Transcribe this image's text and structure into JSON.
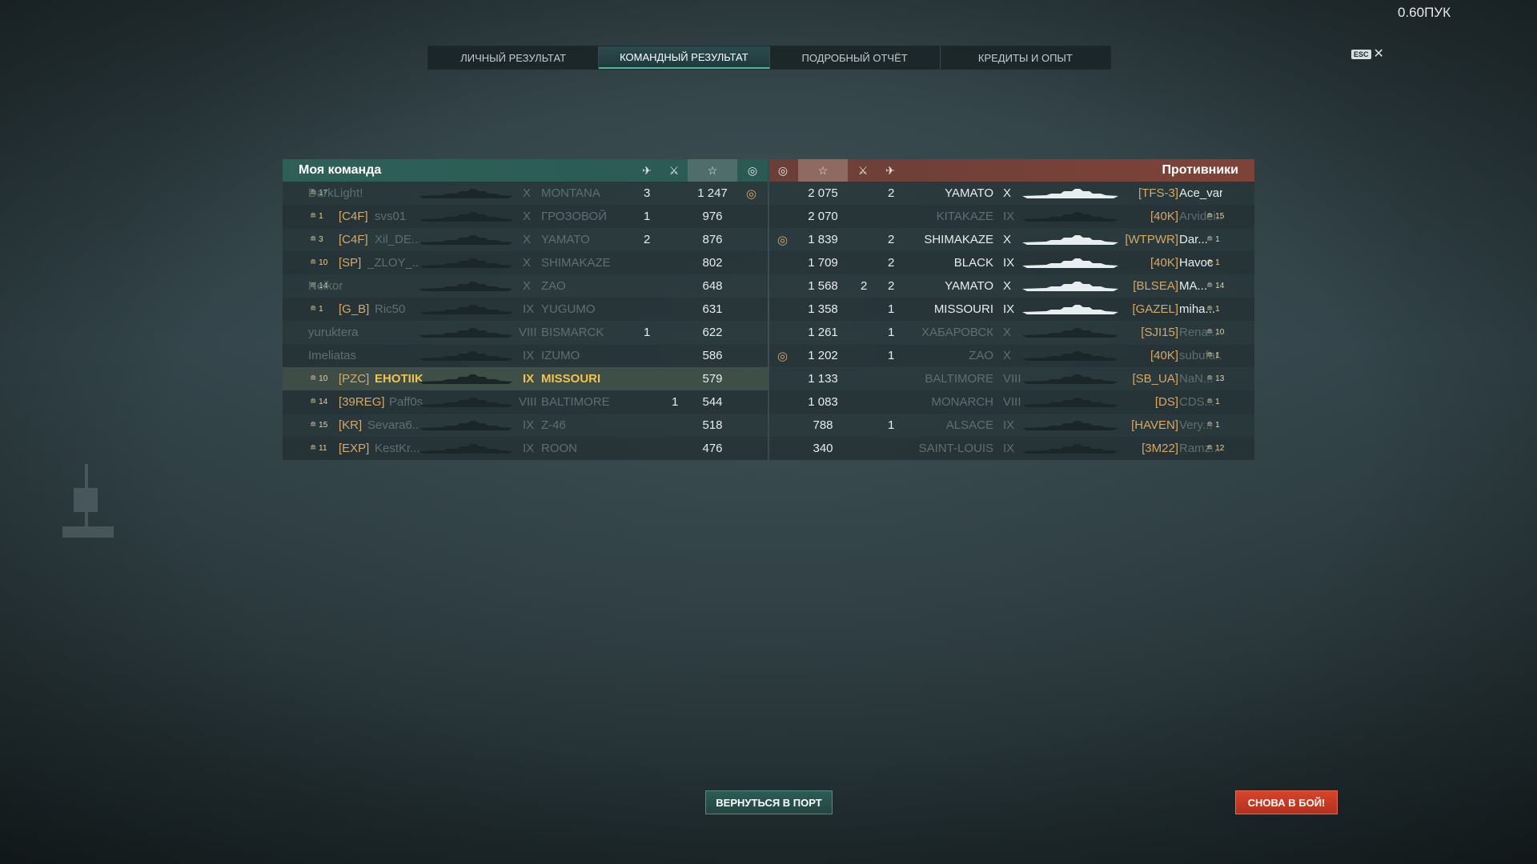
{
  "version": "0.60ПУК",
  "tabs": [
    {
      "label": "ЛИЧНЫЙ РЕЗУЛЬТАТ",
      "active": false
    },
    {
      "label": "КОМАНДНЫЙ РЕЗУЛЬТАТ",
      "active": true
    },
    {
      "label": "ПОДРОБНЫЙ ОТЧЁТ",
      "active": false
    },
    {
      "label": "КРЕДИТЫ И ОПЫТ",
      "active": false
    }
  ],
  "esc": {
    "key": "ESC",
    "close": "✕"
  },
  "my_team": {
    "title": "Моя команда",
    "header_icons": [
      "plane-icon",
      "crossed-swords-icon",
      "star-icon",
      "base-capture-icon"
    ],
    "rows": [
      {
        "rank": "17",
        "clan": "",
        "name": "DarkLight!",
        "tier": "X",
        "ship": "MONTANA",
        "planes": "3",
        "kills": "",
        "score": "1 247",
        "cap": "◎",
        "alive": false,
        "hl": false
      },
      {
        "rank": "1",
        "clan": "[C4F]",
        "name": "svs01",
        "tier": "X",
        "ship": "ГРОЗОВОЙ",
        "planes": "1",
        "kills": "",
        "score": "976",
        "cap": "",
        "alive": false,
        "hl": false
      },
      {
        "rank": "3",
        "clan": "[C4F]",
        "name": "Xil_DE...",
        "tier": "X",
        "ship": "YAMATO",
        "planes": "2",
        "kills": "",
        "score": "876",
        "cap": "",
        "alive": false,
        "hl": false
      },
      {
        "rank": "10",
        "clan": "[SP]",
        "name": "_ZLOY_...",
        "tier": "X",
        "ship": "SHIMAKAZE",
        "planes": "",
        "kills": "",
        "score": "802",
        "cap": "",
        "alive": false,
        "hl": false
      },
      {
        "rank": "14",
        "clan": "",
        "name": "Neikor",
        "tier": "X",
        "ship": "ZAO",
        "planes": "",
        "kills": "",
        "score": "648",
        "cap": "",
        "alive": false,
        "hl": false
      },
      {
        "rank": "1",
        "clan": "[G_B]",
        "name": "Ric50",
        "tier": "IX",
        "ship": "YUGUMO",
        "planes": "",
        "kills": "",
        "score": "631",
        "cap": "",
        "alive": false,
        "hl": false
      },
      {
        "rank": "",
        "clan": "",
        "name": "yuruktera",
        "tier": "VIII",
        "ship": "BISMARCK",
        "planes": "1",
        "kills": "",
        "score": "622",
        "cap": "",
        "alive": false,
        "hl": false
      },
      {
        "rank": "",
        "clan": "",
        "name": "Imeliatas",
        "tier": "IX",
        "ship": "IZUMO",
        "planes": "",
        "kills": "",
        "score": "586",
        "cap": "",
        "alive": false,
        "hl": false
      },
      {
        "rank": "10",
        "clan": "[PZC]",
        "name": "EHOTIIK",
        "tier": "IX",
        "ship": "MISSOURI",
        "planes": "",
        "kills": "",
        "score": "579",
        "cap": "",
        "alive": true,
        "hl": true
      },
      {
        "rank": "14",
        "clan": "[39REG]",
        "name": "Paff0s",
        "tier": "VIII",
        "ship": "BALTIMORE",
        "planes": "",
        "kills": "1",
        "score": "544",
        "cap": "",
        "alive": false,
        "hl": false
      },
      {
        "rank": "15",
        "clan": "[KR]",
        "name": "Sevara6...",
        "tier": "IX",
        "ship": "Z-46",
        "planes": "",
        "kills": "",
        "score": "518",
        "cap": "",
        "alive": false,
        "hl": false
      },
      {
        "rank": "11",
        "clan": "[EXP]",
        "name": "KestKr...",
        "tier": "IX",
        "ship": "ROON",
        "planes": "",
        "kills": "",
        "score": "476",
        "cap": "",
        "alive": false,
        "hl": false
      }
    ]
  },
  "enemy_team": {
    "title": "Противники",
    "header_icons": [
      "base-capture-icon",
      "star-icon",
      "crossed-swords-icon",
      "plane-icon"
    ],
    "rows": [
      {
        "cap": "",
        "score": "2 075",
        "kills": "",
        "planes": "2",
        "ship": "YAMATO",
        "tier": "X",
        "clan": "[TFS-3]",
        "name": "Ace_varvar",
        "rank": "",
        "alive": true
      },
      {
        "cap": "",
        "score": "2 070",
        "kills": "",
        "planes": "",
        "ship": "KITAKAZE",
        "tier": "IX",
        "clan": "[40K]",
        "name": "Arvidei...",
        "rank": "15",
        "alive": false
      },
      {
        "cap": "◎",
        "score": "1 839",
        "kills": "",
        "planes": "2",
        "ship": "SHIMAKAZE",
        "tier": "X",
        "clan": "[WTPWR]",
        "name": "Dar...",
        "rank": "1",
        "alive": true
      },
      {
        "cap": "",
        "score": "1 709",
        "kills": "",
        "planes": "2",
        "ship": "BLACK",
        "tier": "IX",
        "clan": "[40K]",
        "name": "Havoc",
        "rank": "1",
        "alive": true
      },
      {
        "cap": "",
        "score": "1 568",
        "kills": "2",
        "planes": "2",
        "ship": "YAMATO",
        "tier": "X",
        "clan": "[BLSEA]",
        "name": "MA...",
        "rank": "14",
        "alive": true
      },
      {
        "cap": "",
        "score": "1 358",
        "kills": "",
        "planes": "1",
        "ship": "MISSOURI",
        "tier": "IX",
        "clan": "[GAZEL]",
        "name": "miha...",
        "rank": "1",
        "alive": true
      },
      {
        "cap": "",
        "score": "1 261",
        "kills": "",
        "planes": "1",
        "ship": "ХАБАРОВСК",
        "tier": "X",
        "clan": "[SJI15]",
        "name": "Rena...",
        "rank": "10",
        "alive": false
      },
      {
        "cap": "◎",
        "score": "1 202",
        "kills": "",
        "planes": "1",
        "ship": "ZAO",
        "tier": "X",
        "clan": "[40K]",
        "name": "subufar...",
        "rank": "1",
        "alive": false
      },
      {
        "cap": "",
        "score": "1 133",
        "kills": "",
        "planes": "",
        "ship": "BALTIMORE",
        "tier": "VIII",
        "clan": "[SB_UA]",
        "name": "NaN...",
        "rank": "13",
        "alive": false
      },
      {
        "cap": "",
        "score": "1 083",
        "kills": "",
        "planes": "",
        "ship": "MONARCH",
        "tier": "VIII",
        "clan": "[DS]",
        "name": "CDS...",
        "rank": "1",
        "alive": false
      },
      {
        "cap": "",
        "score": "788",
        "kills": "",
        "planes": "1",
        "ship": "ALSACE",
        "tier": "IX",
        "clan": "[HAVEN]",
        "name": "Very...",
        "rank": "1",
        "alive": false
      },
      {
        "cap": "",
        "score": "340",
        "kills": "",
        "planes": "",
        "ship": "SAINT-LOUIS",
        "tier": "IX",
        "clan": "[3M22]",
        "name": "Ramz...",
        "rank": "12",
        "alive": false
      }
    ]
  },
  "buttons": {
    "port": "ВЕРНУТЬСЯ В ПОРТ",
    "battle": "СНОВА В БОЙ!"
  }
}
